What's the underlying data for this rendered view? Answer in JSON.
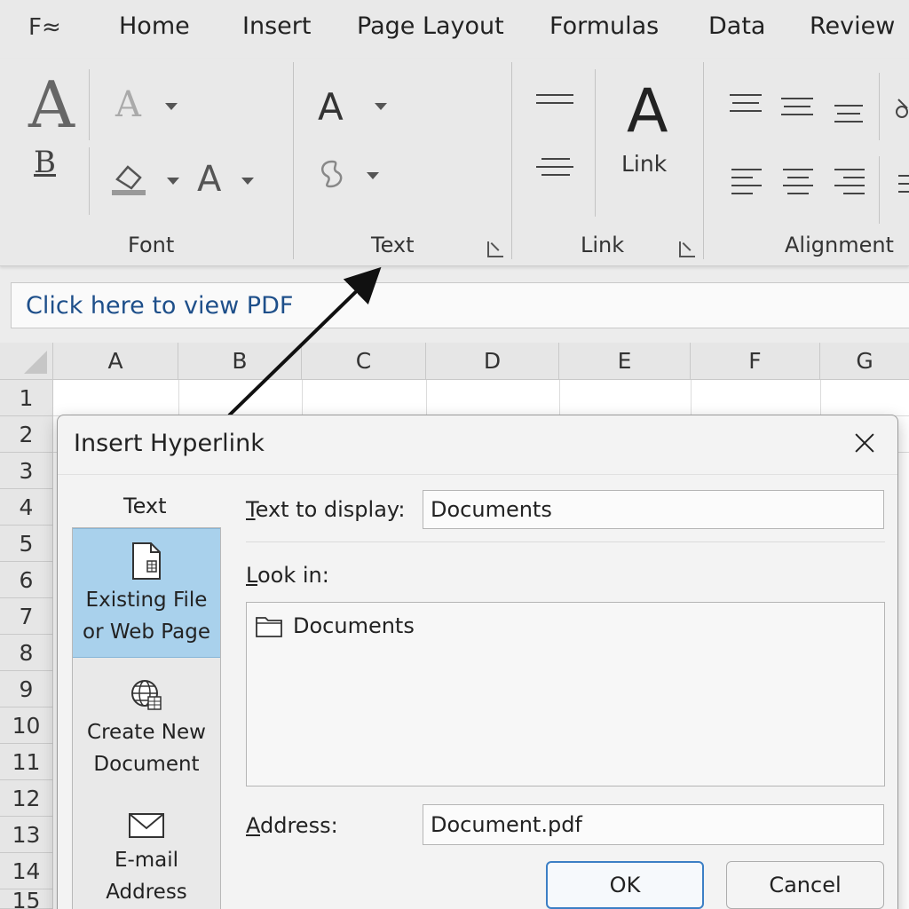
{
  "ribbon": {
    "app_icon": "F≈",
    "tabs": [
      "Home",
      "Insert",
      "Page Layout",
      "Formulas",
      "Data",
      "Review"
    ],
    "groups": {
      "font": "Font",
      "text": "Text",
      "link": "Link",
      "alignment": "Alignment"
    },
    "link_button_label": "Link",
    "glyph_a": "A",
    "glyph_b": "B"
  },
  "namebar": {
    "text": "Click here to view PDF"
  },
  "sheet": {
    "columns": [
      "A",
      "B",
      "C",
      "D",
      "E",
      "F",
      "G"
    ],
    "rows": [
      "1",
      "2",
      "3",
      "4",
      "5",
      "6",
      "7",
      "8",
      "9",
      "10",
      "11",
      "12",
      "13",
      "14",
      "15"
    ]
  },
  "dialog": {
    "title": "Insert Hyperlink",
    "link_to_label": "Text",
    "link_to_items": [
      {
        "line1": "Existing File",
        "line2": "or Web Page"
      },
      {
        "line1": "Create New",
        "line2": "Document"
      },
      {
        "line1": "E-mail",
        "line2": "Address"
      }
    ],
    "text_to_display": {
      "accel": "T",
      "rest": "ext to display:",
      "value": "Documents"
    },
    "look_in": {
      "accel": "L",
      "rest": "ook in:",
      "item": "Documents"
    },
    "address": {
      "accel": "A",
      "rest": "ddress:",
      "value": "Document.pdf"
    },
    "ok_label": "OK",
    "cancel_label": "Cancel"
  },
  "colors": {
    "selected_item": "#a9d1ec",
    "link_text": "#1e4f8a",
    "primary_button_border": "#3c7fc5"
  }
}
